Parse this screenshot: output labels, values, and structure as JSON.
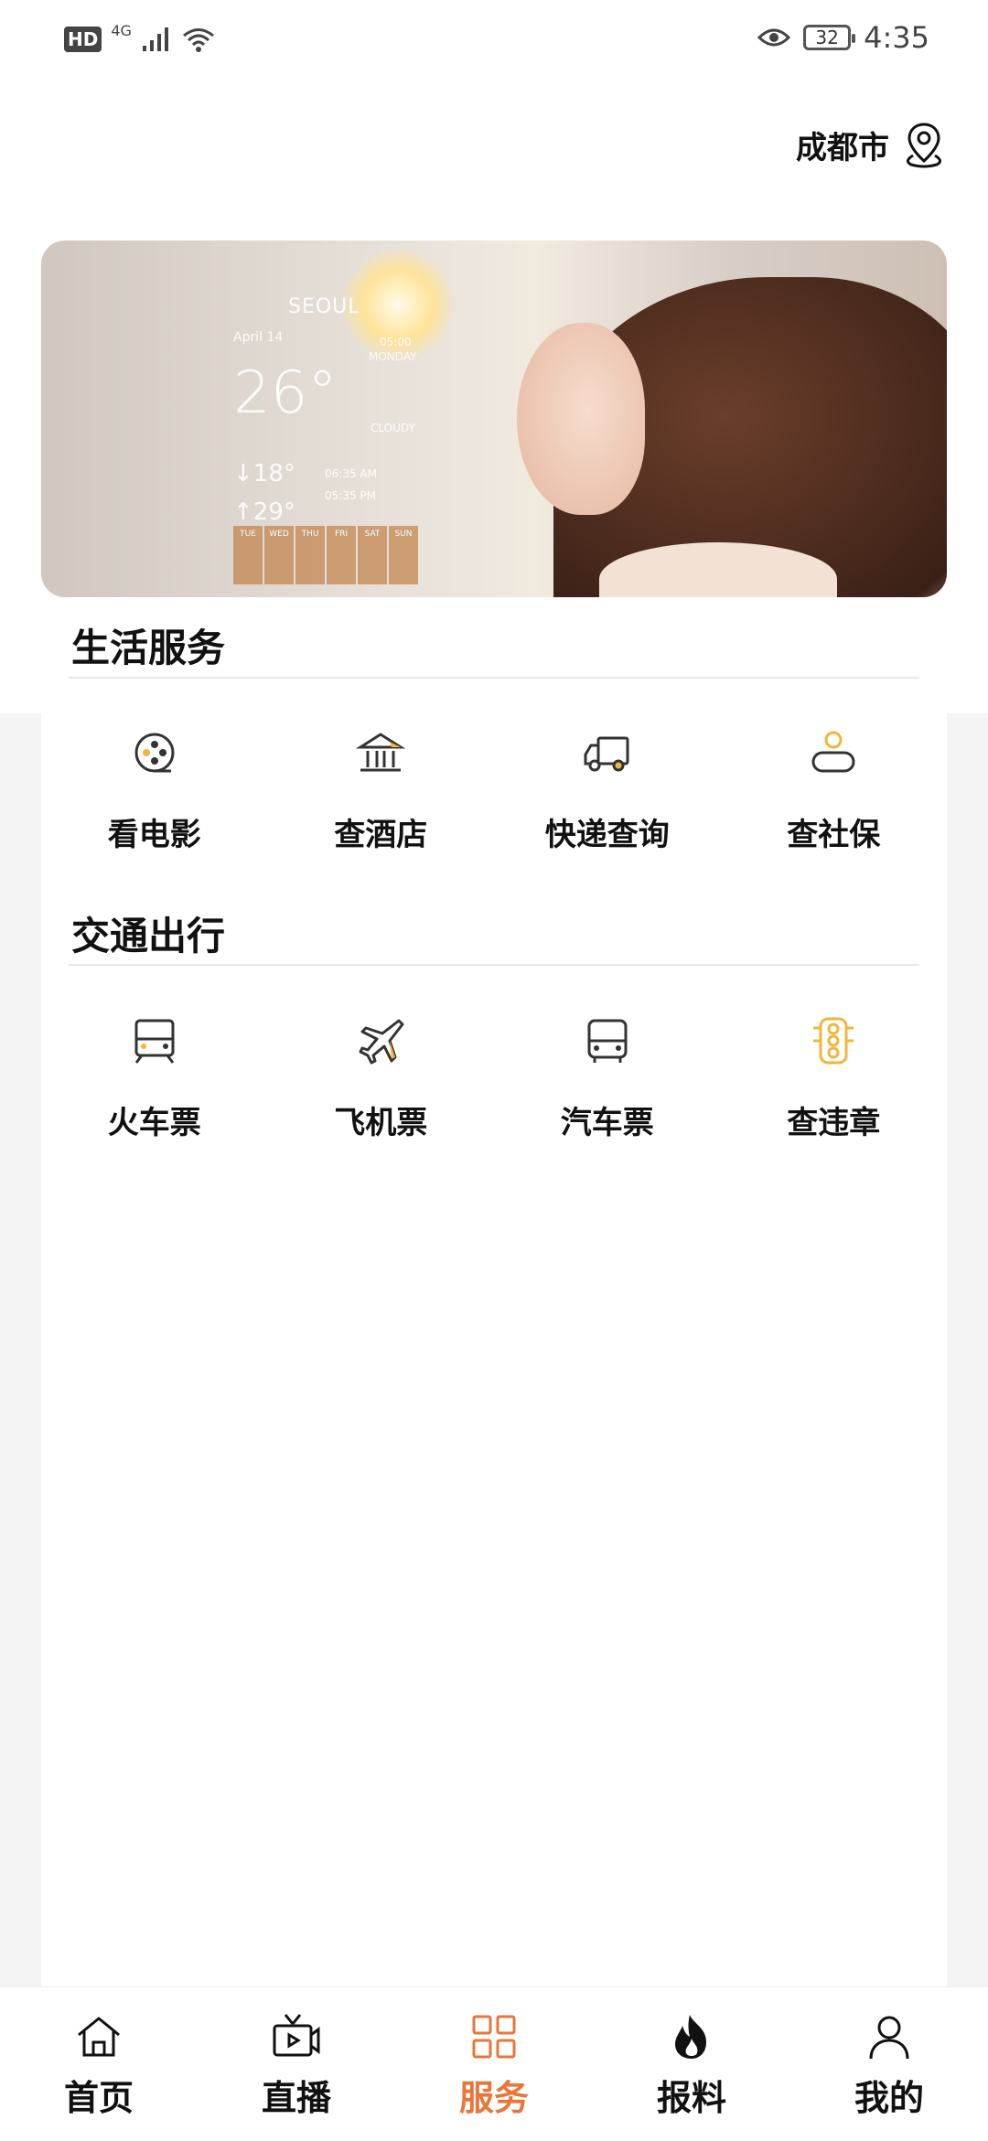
{
  "status_bar": {
    "hd": "HD",
    "network": "4G",
    "battery": "32",
    "time": "4:35"
  },
  "header": {
    "location": "成都市"
  },
  "banner": {
    "city": "SEOUL",
    "date": "April 14",
    "time": "05:00",
    "day": "MONDAY",
    "temp": "26°",
    "condition": "CLOUDY",
    "low": "↓18°",
    "high": "↑29°",
    "sunrise": "06:35 AM",
    "sunset": "05:35 PM",
    "days": [
      "TUE",
      "WED",
      "THU",
      "FRI",
      "SAT",
      "SUN"
    ]
  },
  "sections": [
    {
      "title": "生活服务",
      "items": [
        {
          "label": "看电影",
          "icon": "film-reel-icon"
        },
        {
          "label": "查酒店",
          "icon": "hotel-building-icon"
        },
        {
          "label": "快递查询",
          "icon": "delivery-truck-icon"
        },
        {
          "label": "查社保",
          "icon": "social-security-person-icon"
        }
      ]
    },
    {
      "title": "交通出行",
      "items": [
        {
          "label": "火车票",
          "icon": "train-icon"
        },
        {
          "label": "飞机票",
          "icon": "airplane-icon"
        },
        {
          "label": "汽车票",
          "icon": "bus-icon"
        },
        {
          "label": "查违章",
          "icon": "traffic-light-icon"
        }
      ]
    }
  ],
  "nav": {
    "items": [
      {
        "label": "首页",
        "icon": "home-icon"
      },
      {
        "label": "直播",
        "icon": "tv-live-icon"
      },
      {
        "label": "服务",
        "icon": "grid-services-icon",
        "active": true
      },
      {
        "label": "报料",
        "icon": "flame-icon"
      },
      {
        "label": "我的",
        "icon": "user-icon"
      }
    ]
  },
  "colors": {
    "accent": "#e8763a",
    "icon_highlight": "#f0b63c",
    "icon_stroke": "#333333"
  }
}
